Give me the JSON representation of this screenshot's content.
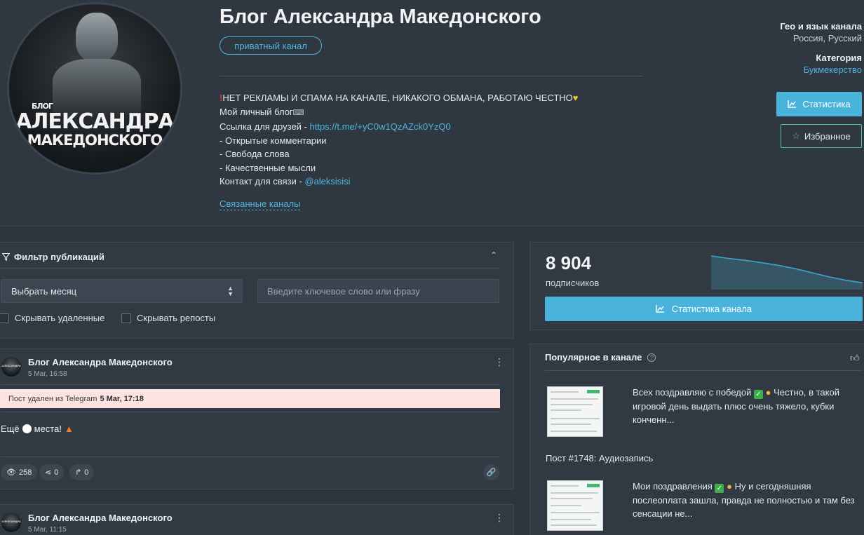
{
  "channel": {
    "title": "Блог Александра Македонского",
    "badge": "приватный канал",
    "avatar_text": [
      "БЛОГ",
      "АЛЕКСАНДРА",
      "МАКЕДОНСКОГО"
    ],
    "description": {
      "line1_icon": "exclamation-icon",
      "line1": "НЕТ РЕКЛАМЫ И СПАМА НА КАНАЛЕ, НИКАКОГО ОБМАНА, РАБОТАЮ ЧЕСТНО",
      "line1_end_icon": "yellow-heart-icon",
      "line2": "Мой личный блог",
      "line2_icon": "keyboard-icon",
      "line3_prefix": "Ссылка для друзей - ",
      "line3_link": "https://t.me/+yC0w1QzAZck0YzQ0",
      "line4": "- Открытые комментарии",
      "line5": "- Свобода слова",
      "line6": "- Качественные мысли",
      "line7_prefix": "Контакт для связи - ",
      "line7_link": "@aleksisisi"
    },
    "related_link": "Связанные каналы"
  },
  "meta": {
    "geo_label": "Гео и язык канала",
    "geo_value": "Россия, Русский",
    "category_label": "Категория",
    "category_value": "Букмекерство"
  },
  "actions": {
    "stats_label": "Статистика",
    "favorite_label": "Избранное"
  },
  "filter": {
    "title": "Фильтр публикаций",
    "month_select": "Выбрать месяц",
    "keyword_placeholder": "Введите ключевое слово или фразу",
    "hide_deleted": "Скрывать удаленные",
    "hide_reposts": "Скрывать репосты"
  },
  "posts": [
    {
      "author": "Блог Александра Македонского",
      "date": "5 Mar, 16:58",
      "deleted_notice": "Пост удален из Telegram",
      "deleted_time": "5 Mar, 17:18",
      "text_before": "Ещё",
      "text_after": "места!",
      "views": "258",
      "shares": "0",
      "forwards": "0"
    },
    {
      "author": "Блог Александра Македонского",
      "date": "5 Mar, 11:15"
    }
  ],
  "subscribers": {
    "count": "8 904",
    "label": "подписчиков",
    "button": "Статистика канала"
  },
  "chart_data": {
    "type": "area",
    "x": [
      0,
      1,
      2,
      3,
      4,
      5,
      6,
      7,
      8,
      9
    ],
    "values": [
      100,
      93,
      87,
      80,
      72,
      62,
      50,
      38,
      28,
      20
    ],
    "ylim": [
      0,
      100
    ],
    "grid": false,
    "color": "#3fa3cc"
  },
  "popular": {
    "title": "Популярное в канале",
    "items": [
      {
        "text_a": "Всех поздравляю с победой",
        "text_b": "Честно, в такой игровой день выдать плюс очень тяжело, кубки конченн..."
      },
      {
        "text": "Пост #1748: Аудиозапись"
      },
      {
        "text_a": "Мои поздравления",
        "text_b": "Ну и сегодняшняя послеоплата зашла, правда не полностью и там без сенсации не..."
      }
    ]
  },
  "colors": {
    "accent": "#4ab3dc",
    "favorite_border": "#4fc3a7",
    "background": "#2e353e",
    "deleted_banner": "#fde2e2"
  }
}
